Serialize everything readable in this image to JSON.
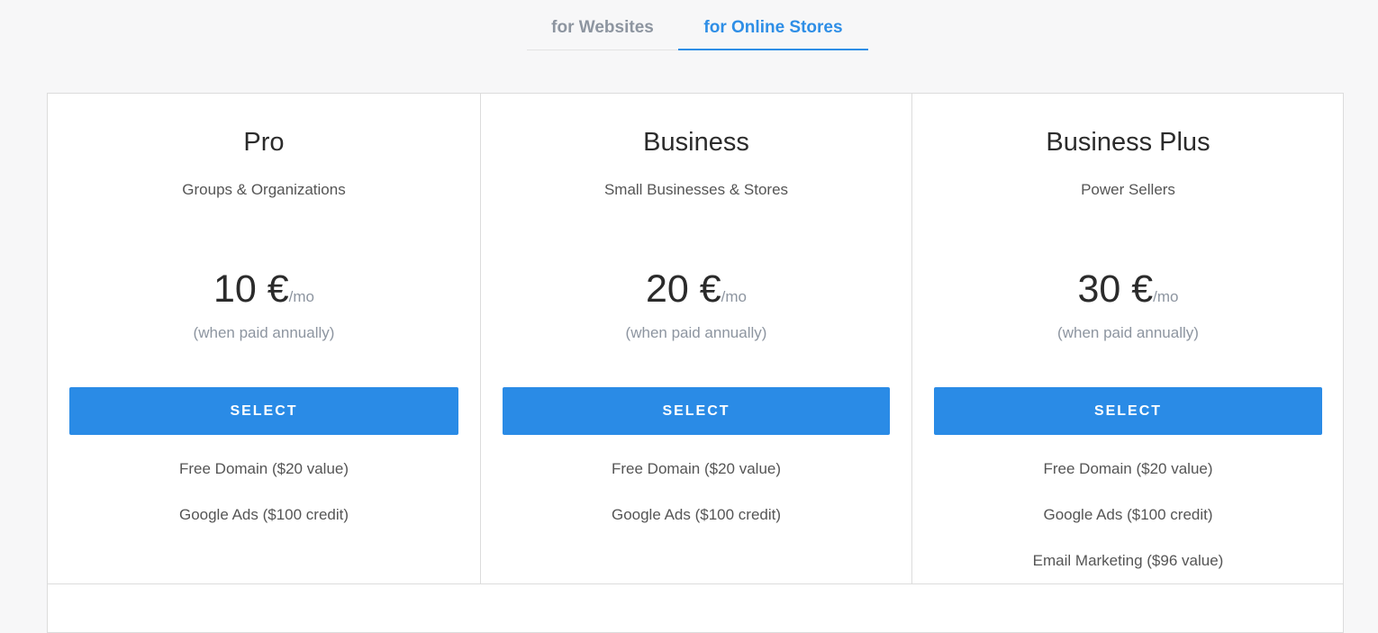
{
  "tabs": {
    "websites": "for Websites",
    "stores": "for Online Stores",
    "active": "stores"
  },
  "colors": {
    "accent": "#2a8be6",
    "muted": "#8d95a0",
    "border": "#dcdcdc"
  },
  "plans": [
    {
      "name": "Pro",
      "audience": "Groups & Organizations",
      "price": "10 €",
      "per": "/mo",
      "note": "(when paid annually)",
      "button": "SELECT",
      "features": [
        "Free Domain ($20 value)",
        "Google Ads ($100 credit)"
      ]
    },
    {
      "name": "Business",
      "audience": "Small Businesses & Stores",
      "price": "20 €",
      "per": "/mo",
      "note": "(when paid annually)",
      "button": "SELECT",
      "features": [
        "Free Domain ($20 value)",
        "Google Ads ($100 credit)"
      ]
    },
    {
      "name": "Business Plus",
      "audience": "Power Sellers",
      "price": "30 €",
      "per": "/mo",
      "note": "(when paid annually)",
      "button": "SELECT",
      "features": [
        "Free Domain ($20 value)",
        "Google Ads ($100 credit)",
        "Email Marketing ($96 value)"
      ]
    }
  ]
}
